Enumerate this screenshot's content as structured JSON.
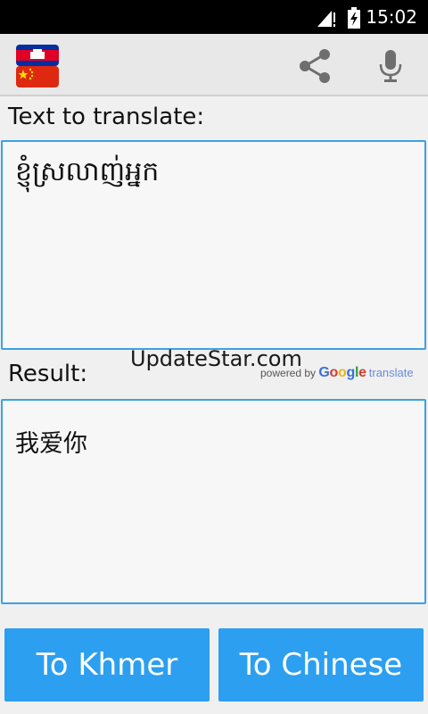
{
  "status_bar": {
    "time": "15:02"
  },
  "action_bar": {
    "app_icon": "cambodia-china-flags-icon",
    "share_icon": "share-icon",
    "mic_icon": "microphone-icon"
  },
  "source": {
    "label": "Text to translate:",
    "value": "ខ្ញុំស្រលាញ់អ្នក"
  },
  "watermark": "UpdateStar.com",
  "powered_by": {
    "prefix": "powered by",
    "brand": "Google",
    "suffix": "translate"
  },
  "result": {
    "label": "Result:",
    "value": "我爱你"
  },
  "buttons": {
    "to_khmer": "To Khmer",
    "to_chinese": "To Chinese"
  },
  "colors": {
    "accent": "#2c9ff0",
    "box_border": "#3aa3e3",
    "status_bar": "#000000",
    "action_bar": "#e8e8e8"
  }
}
